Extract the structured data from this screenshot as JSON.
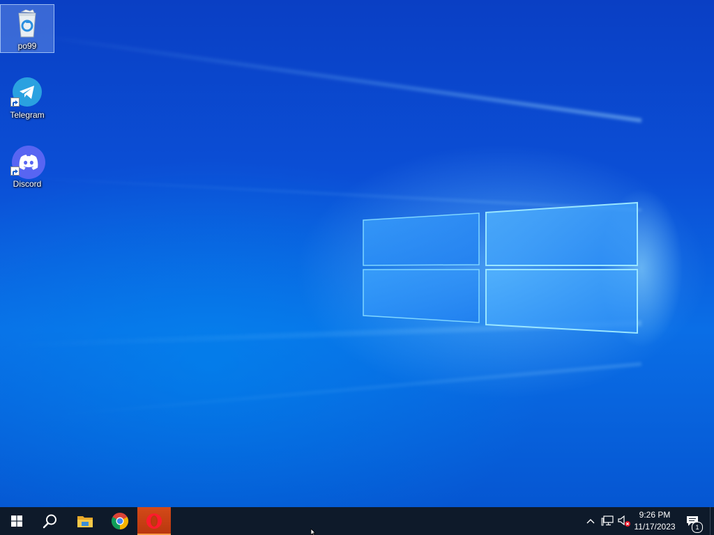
{
  "desktop": {
    "icons": [
      {
        "label": "po99",
        "icon": "recycle-bin-icon",
        "selected": true
      },
      {
        "label": "Telegram",
        "icon": "telegram-icon",
        "shortcut": true
      },
      {
        "label": "Discord",
        "icon": "discord-icon",
        "shortcut": true
      }
    ],
    "wallpaper": "windows-10-hero",
    "colors": {
      "wallpaper_blue": "#0a56d8",
      "logo_light": "#5bbcff"
    }
  },
  "taskbar": {
    "start": "windows-start-icon",
    "search": "search-icon",
    "pinned": [
      {
        "name": "file-explorer-icon",
        "active": false
      },
      {
        "name": "chrome-icon",
        "active": false
      },
      {
        "name": "opera-icon",
        "active": true
      }
    ],
    "tray": {
      "chevron": "chevron-up-icon",
      "network": "network-icon",
      "volume": "volume-muted-icon",
      "time": "9:26 PM",
      "date": "11/17/2023",
      "notifications_count": "1"
    },
    "colors": {
      "taskbar_bg": "#0e1a2a",
      "active_app": "#c0390f"
    }
  }
}
